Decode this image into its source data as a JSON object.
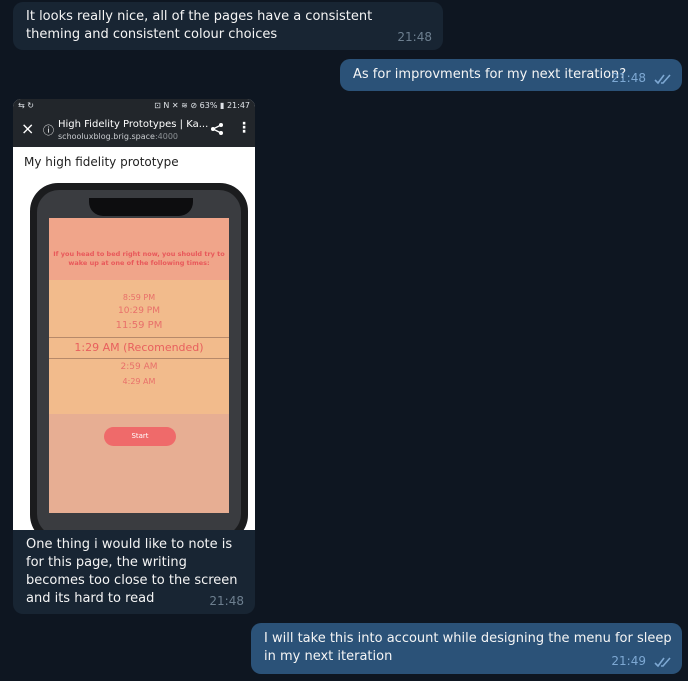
{
  "messages": [
    {
      "text": "It looks really nice, all of the pages have a consistent theming and consistent colour choices",
      "time": "21:48"
    },
    {
      "text": "As for improvments for my next iteration?",
      "time": "21:48"
    },
    {
      "text": "One thing i would like to note is for this page, the writing becomes too close to the screen and its hard to read",
      "time": "21:48"
    },
    {
      "text": "I will take this into account while designing the menu for sleep in my next iteration",
      "time": "21:49"
    }
  ],
  "screenshot": {
    "status": {
      "left": "⇆ ↻",
      "right": "⊡ N ✕ ≋ ⊘ 63% ▮ 21:47"
    },
    "browser": {
      "title": "High Fidelity Prototypes | Ka...",
      "url_host": "schooluxblog.brig.space",
      "url_port": ":4000",
      "close_icon": "×",
      "info_icon": "ⓘ",
      "share_icon": "share-icon",
      "menu_icon": "⋮"
    },
    "page_heading": "My high fidelity prototype",
    "app": {
      "header": "If you head to bed right now, you should try to wake up at one of the following times:",
      "times": [
        "8:59 PM",
        "10:29 PM",
        "11:59 PM"
      ],
      "selected": "1:29 AM (Recomended)",
      "times_after": [
        "2:59 AM",
        "4:29 AM"
      ],
      "start_label": "Start"
    },
    "colors": {
      "app_top": "#f0a58a",
      "app_mid": "#f2bb8c",
      "app_bottom": "#e7ae93",
      "accent": "#ef6a6a"
    }
  }
}
